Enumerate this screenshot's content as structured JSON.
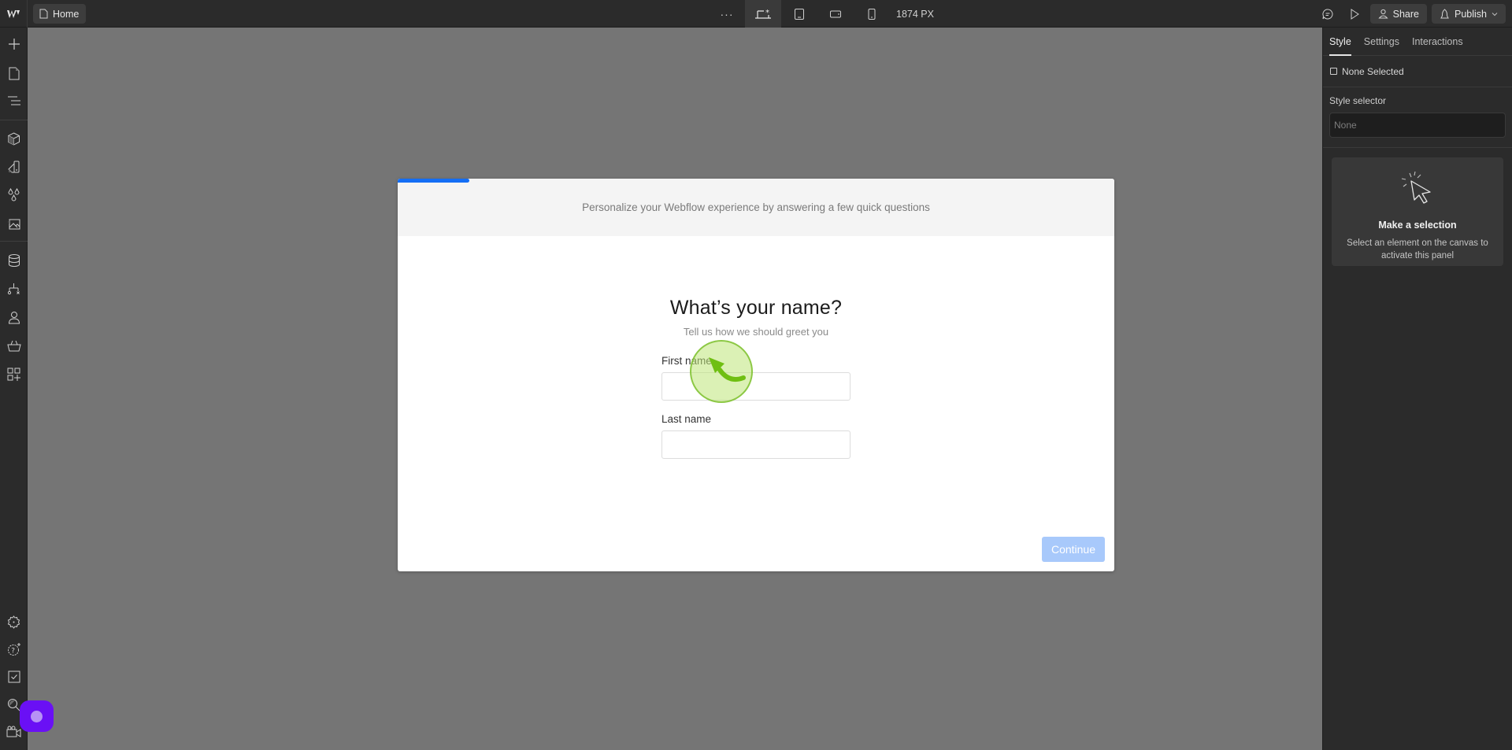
{
  "topbar": {
    "logo": "webflow-logo",
    "page_button_label": "Home",
    "more_label": "···",
    "breakpoints": [
      "desktop-base",
      "tablet",
      "mobile-landscape",
      "mobile-portrait"
    ],
    "active_breakpoint": "desktop-base",
    "width_readout": "1874 PX",
    "share_label": "Share",
    "publish_label": "Publish"
  },
  "left_sidebar": {
    "items": [
      "add",
      "pages",
      "navigator",
      "components",
      "variables",
      "style-manager",
      "assets",
      "cms",
      "logic",
      "users",
      "ecommerce",
      "apps"
    ],
    "bottom_items": [
      "settings",
      "help",
      "audits",
      "find",
      "video-tutorials"
    ]
  },
  "canvas": {
    "progress": 0.1,
    "header_text": "Personalize your Webflow experience by answering a few quick questions",
    "question_title": "What’s your name?",
    "question_subtitle": "Tell us how we should greet you",
    "first_name_label": "First name",
    "first_name_value": "",
    "last_name_label": "Last name",
    "last_name_value": "",
    "continue_label": "Continue"
  },
  "right_panel": {
    "tabs": [
      "Style",
      "Settings",
      "Interactions"
    ],
    "active_tab": "Style",
    "selection_label": "None Selected",
    "style_selector_label": "Style selector",
    "style_selector_placeholder": "None",
    "empty_title": "Make a selection",
    "empty_text": "Select an element on the canvas to activate this panel"
  },
  "colors": {
    "accent": "#146ef5",
    "continue_disabled": "#a8c9fb",
    "chat_button": "#6a10f5"
  }
}
